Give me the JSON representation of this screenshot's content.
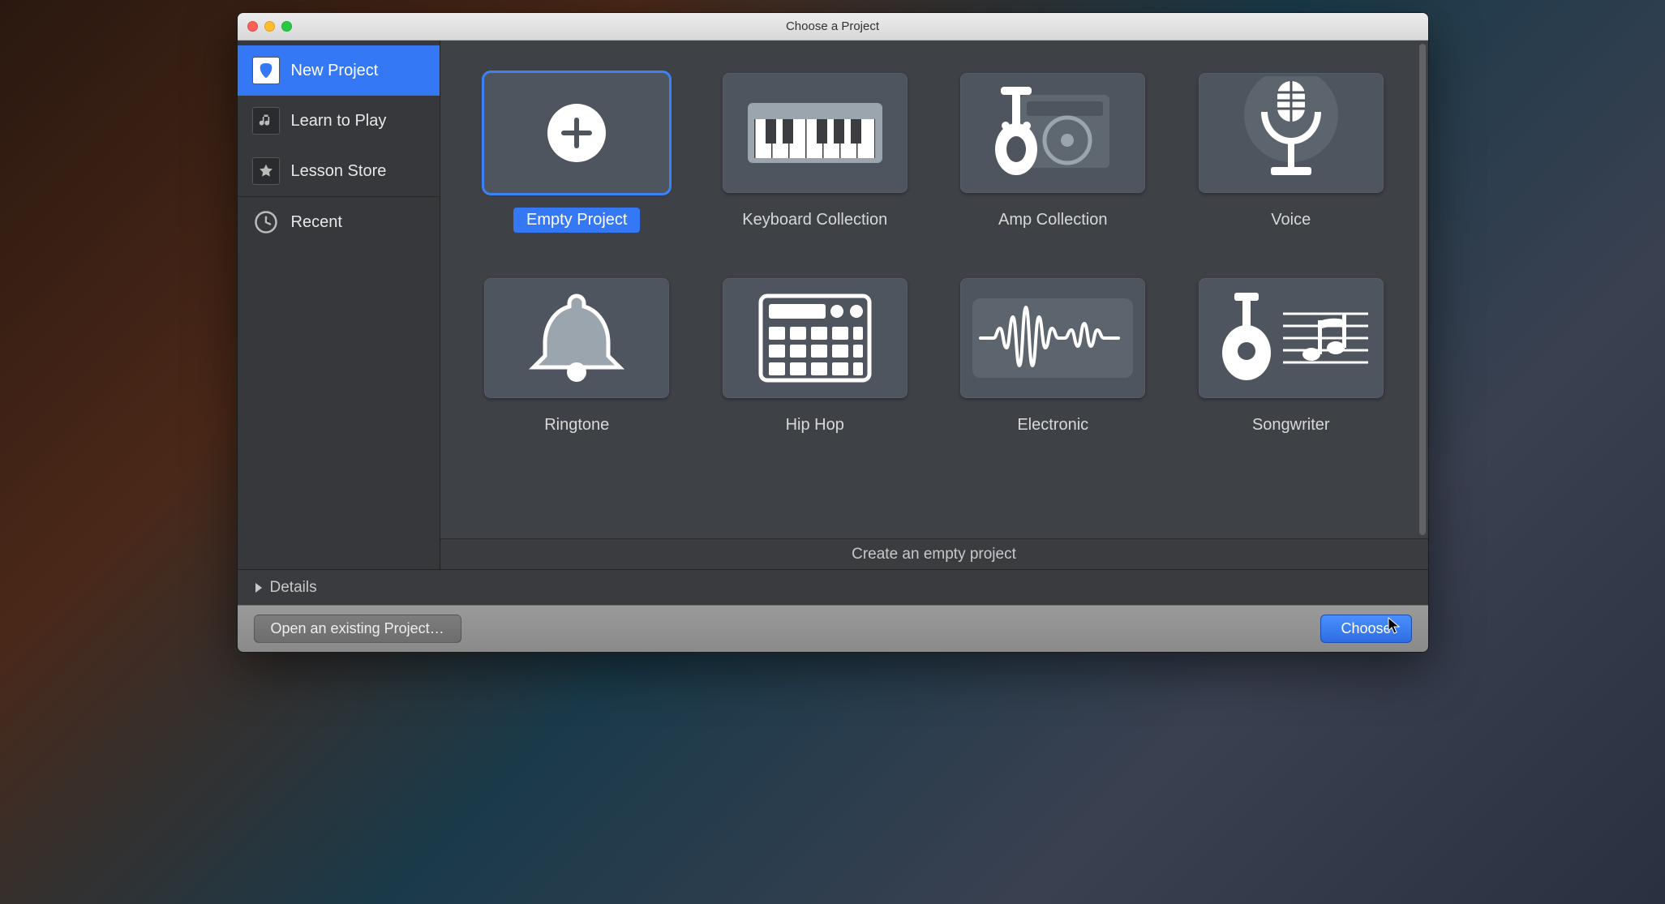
{
  "window": {
    "title": "Choose a Project"
  },
  "sidebar": {
    "items": [
      {
        "label": "New Project",
        "icon": "guitar-pick-icon",
        "selected": true
      },
      {
        "label": "Learn to Play",
        "icon": "music-note-icon",
        "selected": false
      },
      {
        "label": "Lesson Store",
        "icon": "star-icon",
        "selected": false
      },
      {
        "label": "Recent",
        "icon": "clock-icon",
        "selected": false
      }
    ]
  },
  "templates": [
    {
      "label": "Empty Project",
      "icon": "plus-circle-icon",
      "selected": true
    },
    {
      "label": "Keyboard Collection",
      "icon": "keyboard-icon",
      "selected": false
    },
    {
      "label": "Amp Collection",
      "icon": "amp-icon",
      "selected": false
    },
    {
      "label": "Voice",
      "icon": "microphone-icon",
      "selected": false
    },
    {
      "label": "Ringtone",
      "icon": "bell-icon",
      "selected": false
    },
    {
      "label": "Hip Hop",
      "icon": "drum-machine-icon",
      "selected": false
    },
    {
      "label": "Electronic",
      "icon": "waveform-icon",
      "selected": false
    },
    {
      "label": "Songwriter",
      "icon": "songwriter-icon",
      "selected": false
    }
  ],
  "description": "Create an empty project",
  "details": {
    "label": "Details"
  },
  "footer": {
    "open_label": "Open an existing Project…",
    "choose_label": "Choose"
  },
  "colors": {
    "accent": "#3478f6",
    "tile_bg": "#4e555e",
    "panel_bg": "#3e4146"
  }
}
